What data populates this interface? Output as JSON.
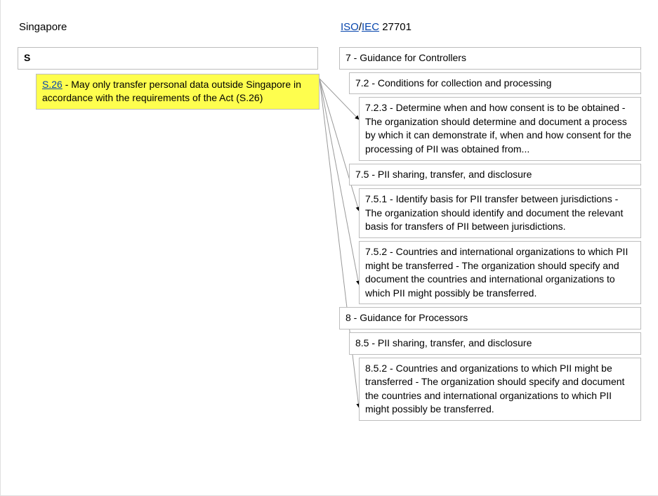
{
  "left": {
    "title": "Singapore",
    "root": "S",
    "leaf_code": "S.26",
    "leaf_text": " - May only transfer personal data outside Singapore in accordance with the requirements of the Act (S.26)"
  },
  "right": {
    "title_link1": "ISO",
    "title_sep": "/",
    "title_link2": "IEC",
    "title_rest": " 27701",
    "n0": "7 - Guidance for Controllers",
    "n1": "7.2 - Conditions for collection and processing",
    "n2": "7.2.3 - Determine when and how consent is to be obtained - The organization should determine and document a process by which it can demonstrate if, when and how consent for the processing of PII was obtained from...",
    "n3": "7.5 - PII sharing, transfer, and disclosure",
    "n4": "7.5.1 - Identify basis for PII transfer between jurisdictions - The organization should identify and document the relevant basis for transfers of PII between jurisdictions.",
    "n5": "7.5.2 - Countries and international organizations to which PII might be transferred - The organization should specify and document the countries and international organizations to which PII might possibly be transferred.",
    "n6": "8 - Guidance for Processors",
    "n7": "8.5 - PII sharing, transfer, and disclosure",
    "n8": "8.5.2 - Countries and organizations to which PII might be transferred - The organization should specify and document the countries and international organizations to which PII might possibly be transferred."
  }
}
